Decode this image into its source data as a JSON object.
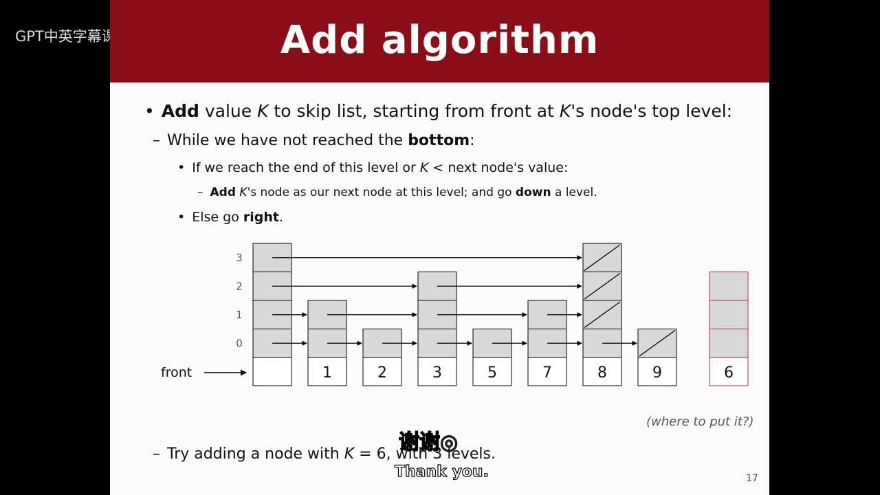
{
  "watermark": {
    "text": "GPT中英字幕课程",
    "logo": "bilibili"
  },
  "slide": {
    "title": "Add algorithm",
    "lines": {
      "l1": {
        "pre": "Add",
        "a": " value ",
        "k": "K",
        "b": " to skip list, starting from front at ",
        "k2": "K",
        "c": "'s node's top level:"
      },
      "l2": {
        "dash": "–",
        "a": "While we have not reached the ",
        "bold": "bottom",
        "c": ":"
      },
      "l3": {
        "a": "If we reach the end of this level or ",
        "k": "K",
        "c": " < next node's value:"
      },
      "l4": {
        "dash": "–",
        "bold1": "Add",
        "k": " K",
        "a": "'s node as our next node at this level;  and go ",
        "bold2": "down",
        "c": " a level."
      },
      "l5": {
        "a": "Else go ",
        "bold": "right",
        "c": "."
      },
      "l6": {
        "dash": "–",
        "a": "Try adding a node with ",
        "k": "K",
        "c": " = 6, with 3 levels."
      }
    },
    "note": "(where to put it?)",
    "page_number": "17"
  },
  "diagram": {
    "level_labels": [
      "3",
      "2",
      "1",
      "0"
    ],
    "front_label": "front",
    "nodes": [
      {
        "value": "1",
        "levels": 2
      },
      {
        "value": "2",
        "levels": 1
      },
      {
        "value": "3",
        "levels": 3
      },
      {
        "value": "5",
        "levels": 1
      },
      {
        "value": "7",
        "levels": 2
      },
      {
        "value": "8",
        "levels": 4
      },
      {
        "value": "9",
        "levels": 1
      }
    ],
    "new_node": {
      "value": "6",
      "levels": 3,
      "color": "#b03030"
    }
  },
  "subtitles": {
    "cn": "谢谢◎",
    "en": "Thank you."
  },
  "colors": {
    "title_bg": "#8b0d16",
    "node_fill": "#d8d8d8"
  }
}
